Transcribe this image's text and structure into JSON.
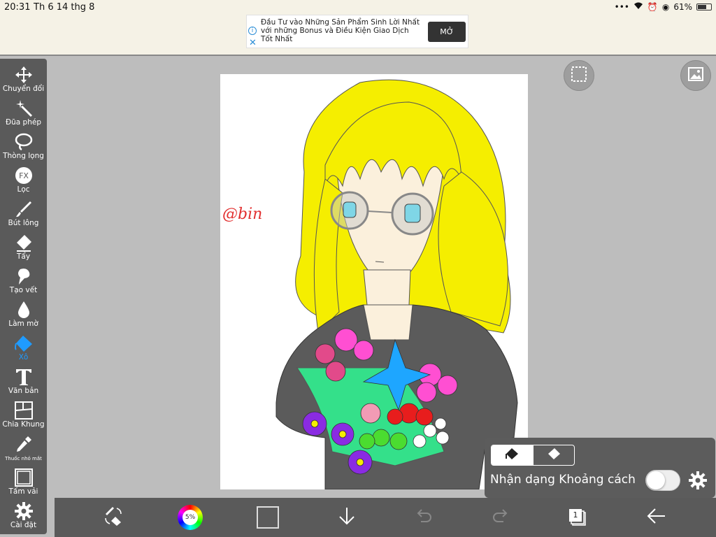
{
  "status": {
    "time": "20:31",
    "date": "Th 6 14 thg 8",
    "battery": "61%"
  },
  "ad": {
    "text": "Đầu Tư vào Những Sản Phẩm Sinh Lời Nhất với những Bonus và Điều Kiện Giao Dịch Tốt Nhất",
    "button": "MỞ"
  },
  "tools": [
    {
      "label": "Chuyển đổi",
      "icon": "move-icon"
    },
    {
      "label": "Đũa phép",
      "icon": "magic-wand-icon"
    },
    {
      "label": "Thòng lọng",
      "icon": "lasso-icon"
    },
    {
      "label": "Lọc",
      "icon": "fx-filter-icon"
    },
    {
      "label": "Bút lông",
      "icon": "brush-icon"
    },
    {
      "label": "Tẩy",
      "icon": "eraser-icon"
    },
    {
      "label": "Tạo vết",
      "icon": "smudge-icon"
    },
    {
      "label": "Làm mờ",
      "icon": "blur-icon"
    },
    {
      "label": "Xô",
      "icon": "fill-bucket-icon",
      "active": true
    },
    {
      "label": "Văn bản",
      "icon": "text-icon"
    },
    {
      "label": "Chia Khung",
      "icon": "frame-divider-icon"
    },
    {
      "label": "Thuốc nhỏ mắt",
      "icon": "eyedropper-icon"
    },
    {
      "label": "Tấm vải",
      "icon": "canvas-icon"
    },
    {
      "label": "Cài đặt",
      "icon": "settings-gear-icon"
    }
  ],
  "canvas": {
    "signature": "@bin"
  },
  "fill_panel": {
    "label": "Nhận dạng Khoảng cách",
    "toggle_on": false
  },
  "bottom": {
    "brush_percent": "5%",
    "layer_count": "1"
  },
  "colors": {
    "accent": "#1f9bff",
    "toolbar": "#5a5a5a",
    "current_color": "#5b5b5b"
  }
}
